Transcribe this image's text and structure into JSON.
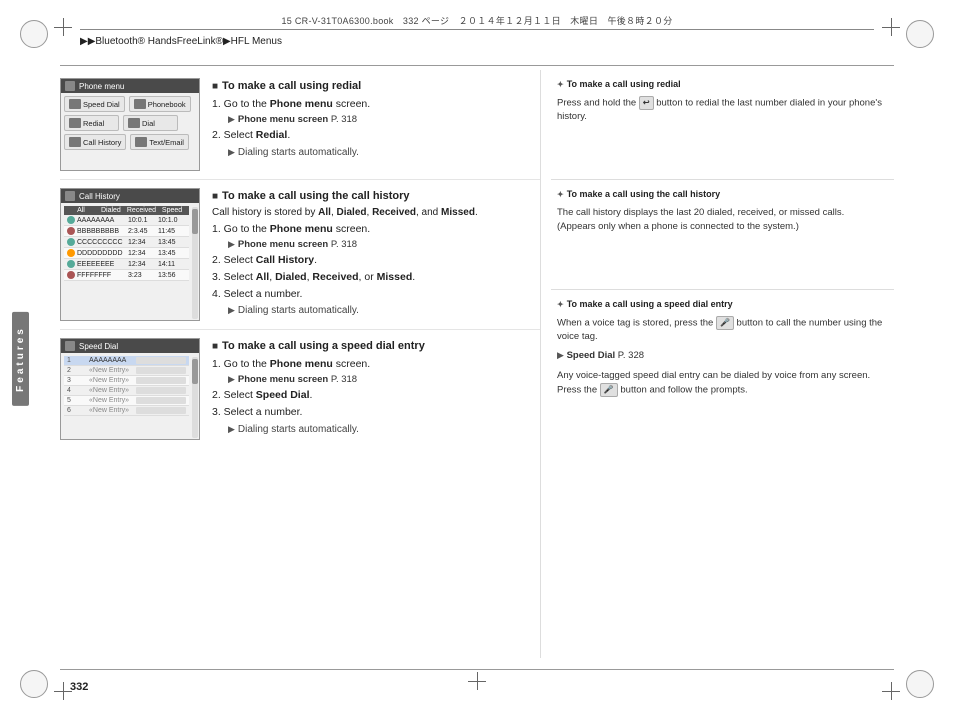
{
  "page": {
    "number": "332",
    "book_info": "15 CR-V-31T0A6300.book　332 ページ　２０１４年１２月１１日　木曜日　午後８時２０分",
    "breadcrumb": "▶▶Bluetooth® HandsFreeLink®▶HFL Menus"
  },
  "sections": [
    {
      "id": "redial",
      "title": "To make a call using redial",
      "steps": [
        {
          "num": "1.",
          "text": "Go to the Phone menu screen.",
          "sub": "Phone menu screen P. 318"
        },
        {
          "num": "2.",
          "text": "Select Redial.",
          "bold_parts": [
            "Redial"
          ]
        },
        {
          "dialing": "Dialing starts automatically."
        }
      ],
      "screen": {
        "title": "Phone menu",
        "type": "phone_menu"
      },
      "note_title": "To make a call using redial",
      "note_text": "Press and hold the button to redial the last number dialed in your phone's history."
    },
    {
      "id": "call_history",
      "title": "To make a call using the call history",
      "intro": "Call history is stored by All, Dialed, Received, and Missed.",
      "intro_bold": [
        "All",
        "Dialed",
        "Received",
        "Missed"
      ],
      "steps": [
        {
          "num": "1.",
          "text": "Go to the Phone menu screen.",
          "sub": "Phone menu screen P. 318"
        },
        {
          "num": "2.",
          "text": "Select Call History.",
          "bold_parts": [
            "Call History"
          ]
        },
        {
          "num": "3.",
          "text": "Select All, Dialed, Received, or Missed.",
          "bold_parts": [
            "All",
            "Dialed",
            "Received",
            "Missed"
          ]
        },
        {
          "num": "4.",
          "text": "Select a number."
        },
        {
          "dialing": "Dialing starts automatically."
        }
      ],
      "screen": {
        "title": "Call History",
        "type": "call_history"
      },
      "note_title": "To make a call using the call history",
      "note_text": "The call history displays the last 20 dialed, received, or missed calls.\n(Appears only when a phone is connected to the system.)"
    },
    {
      "id": "speed_dial",
      "title": "To make a call using a speed dial entry",
      "steps": [
        {
          "num": "1.",
          "text": "Go to the Phone menu screen.",
          "sub": "Phone menu screen P. 318"
        },
        {
          "num": "2.",
          "text": "Select Speed Dial.",
          "bold_parts": [
            "Speed Dial"
          ]
        },
        {
          "num": "3.",
          "text": "Select a number."
        },
        {
          "dialing": "Dialing starts automatically."
        }
      ],
      "screen": {
        "title": "Speed Dial",
        "type": "speed_dial"
      },
      "note_title": "To make a call using a speed dial entry",
      "note_text1": "When a voice tag is stored, press the button to call the number using the voice tag.",
      "note_ref": "Speed Dial P. 328",
      "note_text2": "Any voice-tagged speed dial entry can be dialed by voice from any screen.\nPress the button and follow the prompts."
    }
  ],
  "features_label": "Features",
  "call_history_headers": [
    "All",
    "Dialed",
    "Received",
    "Speed"
  ],
  "call_history_rows": [
    {
      "status": "in",
      "name": "AAAAAAAA",
      "num1": "10:0.1",
      "num2": "10:1.0"
    },
    {
      "status": "out",
      "name": "BBBBBBBBB",
      "num1": "2:3.45",
      "num2": "11:45"
    },
    {
      "status": "in",
      "name": "CCCCCCCCC",
      "num1": "12:34",
      "num2": "13:45"
    },
    {
      "status": "missed",
      "name": "DDDDDDDDD",
      "num1": "12:34",
      "num2": "13:45"
    },
    {
      "status": "in",
      "name": "EEEEEEEE",
      "num1": "12:34",
      "num2": "14:11"
    },
    {
      "status": "out",
      "name": "FFFFFFFF",
      "num1": "3:23",
      "num2": "13:56"
    }
  ],
  "speed_dial_rows": [
    {
      "name": "AAAAAAAA",
      "tag": true
    },
    {
      "name": "«New Entry»"
    },
    {
      "name": "«New Entry»"
    },
    {
      "name": "«New Entry»"
    },
    {
      "name": "«New Entry»"
    },
    {
      "name": "«New Entry»"
    }
  ]
}
